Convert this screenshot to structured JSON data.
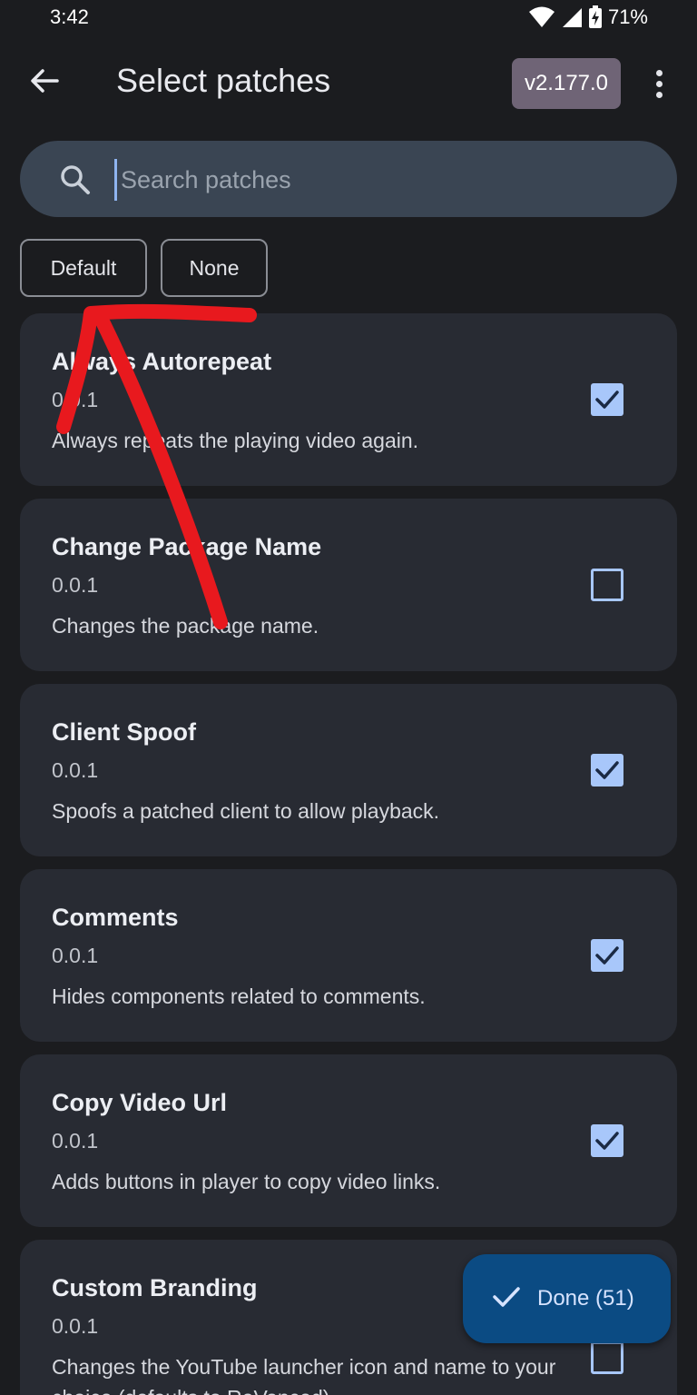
{
  "status_bar": {
    "time": "3:42",
    "battery": "71%",
    "icons": [
      "wifi-icon",
      "cell-signal-icon",
      "battery-charging-icon"
    ]
  },
  "app_bar": {
    "title": "Select patches",
    "version": "v2.177.0",
    "back_icon": "arrow-back-icon",
    "menu_icon": "more-vert-icon"
  },
  "search": {
    "placeholder": "Search patches",
    "value": ""
  },
  "filters": {
    "default_label": "Default",
    "none_label": "None"
  },
  "patches": [
    {
      "name": "Always Autorepeat",
      "version": "0.0.1",
      "description": "Always repeats the playing video again.",
      "checked": true
    },
    {
      "name": "Change Package Name",
      "version": "0.0.1",
      "description": "Changes the package name.",
      "checked": false
    },
    {
      "name": "Client Spoof",
      "version": "0.0.1",
      "description": "Spoofs a patched client to allow playback.",
      "checked": true
    },
    {
      "name": "Comments",
      "version": "0.0.1",
      "description": "Hides components related to comments.",
      "checked": true
    },
    {
      "name": "Copy Video Url",
      "version": "0.0.1",
      "description": "Adds buttons in player to copy video links.",
      "checked": true
    },
    {
      "name": "Custom Branding",
      "version": "0.0.1",
      "description": "Changes the YouTube launcher icon and name to your choice (defaults to ReVanced).",
      "checked": false
    }
  ],
  "fab": {
    "label": "Done (51)",
    "icon": "check-icon"
  },
  "colors": {
    "background": "#1b1c1f",
    "card": "#282b33",
    "search_bg": "#3a4553",
    "accent": "#a8c7fa",
    "chip": "#6f6476",
    "fab": "#0b4b83",
    "annotation": "#e8191e"
  }
}
